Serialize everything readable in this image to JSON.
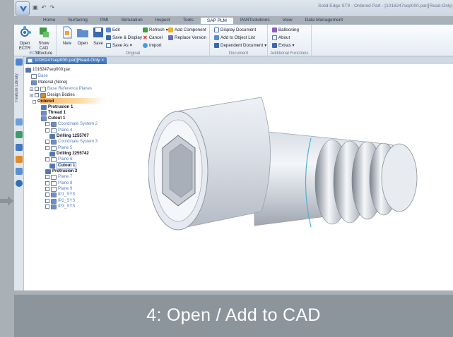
{
  "window": {
    "title": "Solid Edge ST9 - Ordered Part - [1016247sep000.par][Read-Only]"
  },
  "tabs": [
    "Home",
    "Surfacing",
    "PMI",
    "Simulation",
    "Inspect",
    "Tools",
    "SAP PLM",
    "PARTsolutions",
    "View",
    "Data Management"
  ],
  "active_tab": "SAP PLM",
  "ribbon": {
    "ectr": {
      "open_label": "Open ECTR",
      "show_label": "Show CAD Structure",
      "group": "ECTR"
    },
    "original": {
      "new": "New",
      "open": "Open",
      "save": "Save",
      "edit": "Edit",
      "save_display": "Save & Display",
      "save_as": "Save As",
      "refresh": "Refresh",
      "cancel": "Cancel",
      "import": "Import",
      "add_component": "Add Component",
      "replace_version": "Replace Version",
      "group": "Original"
    },
    "document": {
      "display": "Display Document",
      "add_list": "Add to Object List",
      "dependent": "Dependent Document",
      "group": "Document"
    },
    "additional": {
      "ballooning": "Ballooning",
      "about": "About",
      "extras": "Extras",
      "group": "Additional Functions"
    }
  },
  "sidebar": {
    "feature_library": "Feature Library"
  },
  "document_tab": {
    "label": "1016247sep000.par][Read-Only ×"
  },
  "tree": {
    "root": "1016247sep000.par",
    "items": [
      "Base",
      "Material (None)",
      "Base Reference Planes",
      "Design Bodies",
      "Ordered",
      "Protrusion 1",
      "Thread 1",
      "Cutout 1",
      "Coordinate System 2",
      "Plane 4",
      "Drilling 1255707",
      "Coordinate System 3",
      "Plane 5",
      "Drilling 2255742",
      "Plane 6",
      "Cutout 1",
      "Protrusion 2",
      "Plane 7",
      "Plane 8",
      "Plane 9",
      "IP1_SYS",
      "IP2_SYS",
      "IP3_SYS"
    ]
  },
  "caption": "4: Open  / Add to CAD",
  "colors": {
    "accent": "#3b6fb6",
    "ordered": "#f6b55c",
    "caption_bg": "#8d959c"
  }
}
